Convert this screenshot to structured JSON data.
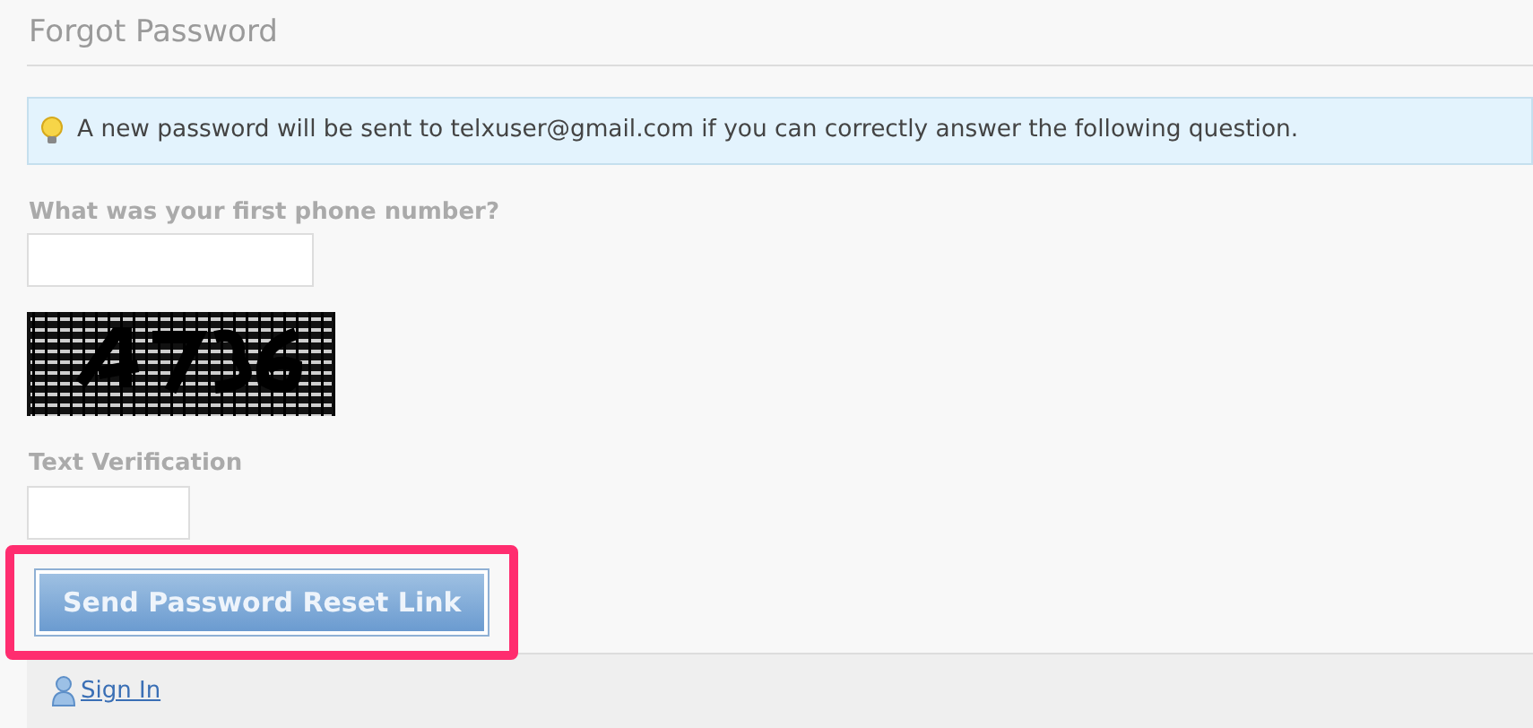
{
  "title": "Forgot Password",
  "notice": "A new password will be sent to telxuser@gmail.com if you can correctly answer the following question.",
  "question": {
    "label": "What was your first phone number?"
  },
  "verification": {
    "label": "Text Verification"
  },
  "submit": {
    "label": "Send Password Reset Link",
    "highlighted": true
  },
  "footer": {
    "link": "Sign In"
  }
}
